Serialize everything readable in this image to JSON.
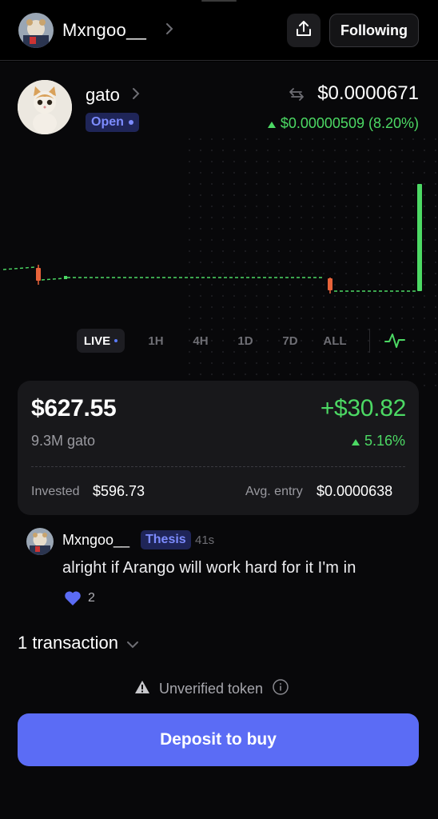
{
  "header": {
    "username": "Mxngoo__",
    "follow_label": "Following"
  },
  "token": {
    "name": "gato",
    "status": "Open",
    "price": "$0.0000671",
    "change": "$0.00000509 (8.20%)"
  },
  "timeframes": [
    "LIVE",
    "1H",
    "4H",
    "1D",
    "7D",
    "ALL"
  ],
  "position": {
    "value": "$627.55",
    "pnl": "+$30.82",
    "amount": "9.3M gato",
    "pnl_pct": "5.16%",
    "invested_label": "Invested",
    "invested_value": "$596.73",
    "avg_label": "Avg. entry",
    "avg_value": "$0.0000638"
  },
  "comment": {
    "author": "Mxngoo__",
    "tag": "Thesis",
    "time": "41s",
    "text": "alright if Arango will work hard for it I'm in",
    "likes": "2"
  },
  "transactions_label": "1 transaction",
  "unverified_label": "Unverified token",
  "deposit_label": "Deposit to buy",
  "colors": {
    "accent": "#5b6cf5",
    "positive": "#4cd964",
    "negative": "#e8633a",
    "badge_bg": "#1f2558",
    "badge_text": "#7d8cff"
  },
  "icons": [
    "chevron-right-icon",
    "share-icon",
    "swap-icon",
    "caret-up-icon",
    "pulse-icon",
    "heart-icon",
    "chevron-down-icon",
    "warning-icon",
    "info-icon"
  ]
}
